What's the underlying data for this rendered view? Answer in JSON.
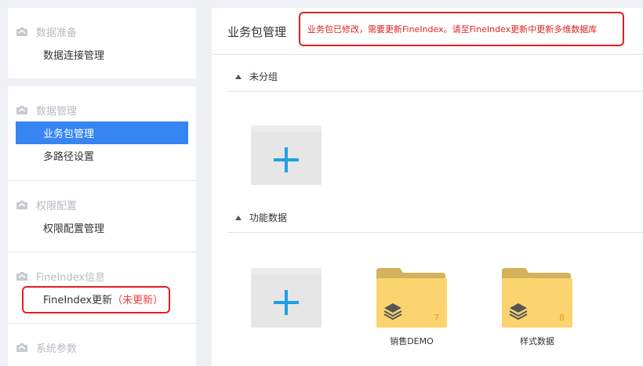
{
  "sidebar": {
    "groups": [
      {
        "title": "数据准备",
        "items": [
          {
            "label": "数据连接管理"
          }
        ]
      },
      {
        "title": "数据管理",
        "items": [
          {
            "label": "业务包管理",
            "active": true
          },
          {
            "label": "多路径设置"
          }
        ]
      },
      {
        "title": "权限配置",
        "items": [
          {
            "label": "权限配置管理"
          }
        ]
      },
      {
        "title": "FineIndex信息",
        "items": [
          {
            "label": "FineIndex更新",
            "suffix": "（未更新）"
          }
        ]
      },
      {
        "title": "系统参数",
        "items": []
      }
    ]
  },
  "main": {
    "title": "业务包管理",
    "notice": "业务包已修改，需要更新FineIndex。请至FineIndex更新中更新多维数据库",
    "sections": [
      {
        "title": "未分组",
        "packages": []
      },
      {
        "title": "功能数据",
        "packages": [
          {
            "name": "销售DEMO",
            "count": "7"
          },
          {
            "name": "样式数据",
            "count": "8"
          }
        ]
      }
    ]
  },
  "colors": {
    "accent": "#3685f2",
    "plus": "#1ea0e6",
    "folder": "#fbd470",
    "alert": "#e02020"
  },
  "icons": {
    "group_icon": "cloud-folder-icon",
    "add": "plus-icon",
    "package": "layers-icon"
  }
}
